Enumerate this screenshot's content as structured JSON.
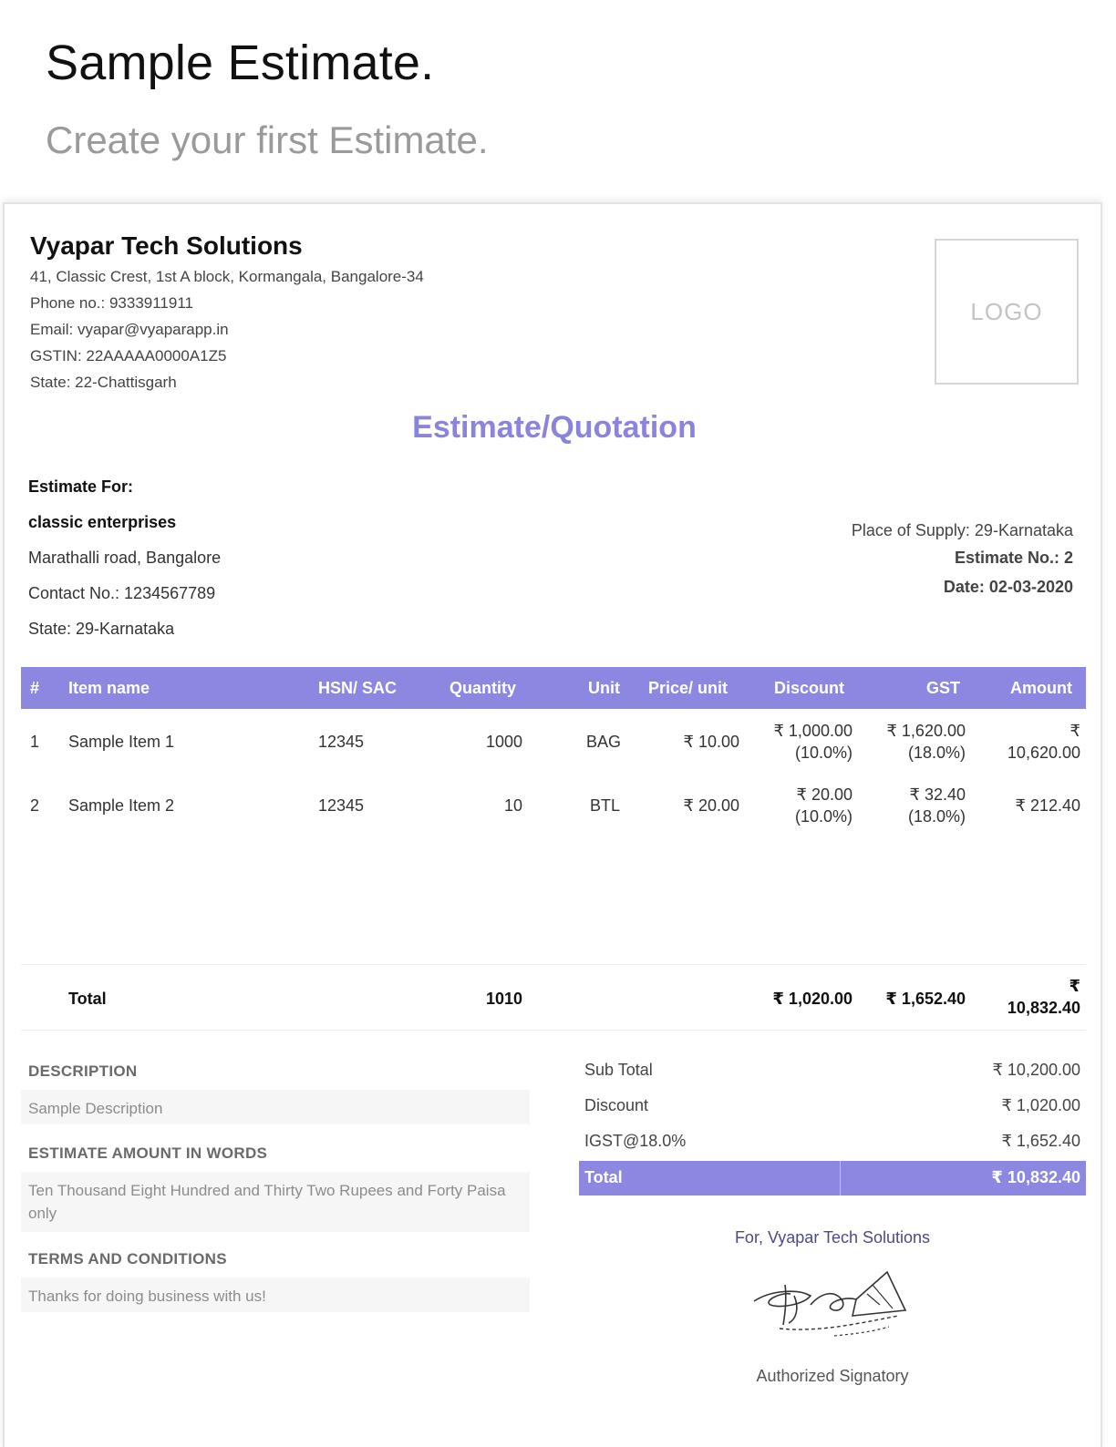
{
  "header": {
    "title": "Sample Estimate.",
    "subtitle": "Create your first Estimate."
  },
  "company": {
    "name": "Vyapar Tech Solutions",
    "address": "41, Classic Crest, 1st A block, Kormangala, Bangalore-34",
    "phone": "Phone no.: 9333911911",
    "email": "Email: vyapar@vyaparapp.in",
    "gstin": "GSTIN: 22AAAAA0000A1Z5",
    "state": "State: 22-Chattisgarh",
    "logo_text": "LOGO"
  },
  "document": {
    "title": "Estimate/Quotation"
  },
  "bill_to": {
    "label": "Estimate For:",
    "name": "classic enterprises",
    "address": "Marathalli road, Bangalore",
    "contact": "Contact No.: 1234567789",
    "state": "State: 29-Karnataka"
  },
  "estimate_info": {
    "place_of_supply": "Place of Supply: 29-Karnataka",
    "number": "Estimate No.: 2",
    "date": "Date: 02-03-2020"
  },
  "table": {
    "headers": {
      "index": "#",
      "item": "Item name",
      "hsn": "HSN/ SAC",
      "qty": "Quantity",
      "unit": "Unit",
      "price": "Price/ unit",
      "discount": "Discount",
      "gst": "GST",
      "amount": "Amount"
    },
    "rows": [
      {
        "index": "1",
        "item": "Sample Item 1",
        "hsn": "12345",
        "qty": "1000",
        "unit": "BAG",
        "price": "₹ 10.00",
        "discount_amt": "₹ 1,000.00",
        "discount_pct": "(10.0%)",
        "gst_amt": "₹ 1,620.00",
        "gst_pct": "(18.0%)",
        "amount_sym": "₹",
        "amount_val": "10,620.00"
      },
      {
        "index": "2",
        "item": "Sample Item 2",
        "hsn": "12345",
        "qty": "10",
        "unit": "BTL",
        "price": "₹ 20.00",
        "discount_amt": "₹ 20.00",
        "discount_pct": "(10.0%)",
        "gst_amt": "₹ 32.40",
        "gst_pct": "(18.0%)",
        "amount": "₹ 212.40"
      }
    ],
    "total": {
      "label": "Total",
      "qty": "1010",
      "discount": "₹ 1,020.00",
      "gst": "₹ 1,652.40",
      "amount_sym": "₹",
      "amount_val": "10,832.40"
    }
  },
  "description": {
    "label": "DESCRIPTION",
    "text": "Sample Description"
  },
  "amount_words": {
    "label": "ESTIMATE AMOUNT IN WORDS",
    "text": "Ten Thousand Eight Hundred and Thirty Two Rupees and Forty Paisa only"
  },
  "terms": {
    "label": "TERMS AND CONDITIONS",
    "text": "Thanks for doing business with us!"
  },
  "summary": {
    "sub_total_label": "Sub Total",
    "sub_total": "₹ 10,200.00",
    "discount_label": "Discount",
    "discount": "₹ 1,020.00",
    "tax_label": "IGST@18.0%",
    "tax": "₹ 1,652.40",
    "total_label": "Total",
    "total": "₹ 10,832.40"
  },
  "signature": {
    "for_company": "For, Vyapar Tech Solutions",
    "label": "Authorized Signatory"
  },
  "colors": {
    "accent": "#8c88e2",
    "title_accent": "#8a84dc"
  }
}
